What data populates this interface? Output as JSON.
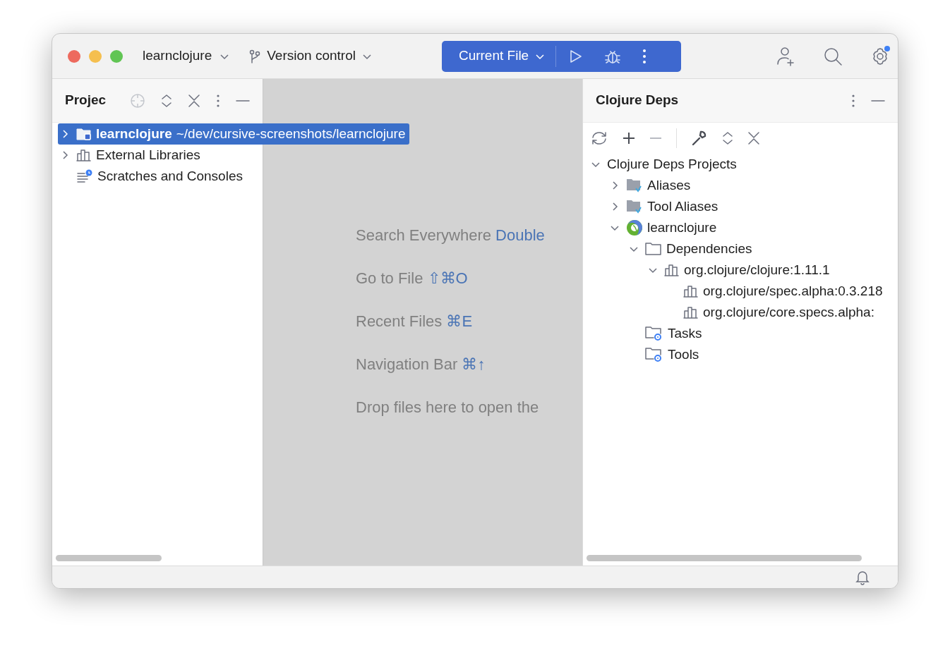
{
  "title_bar": {
    "project": "learnclojure",
    "vcs": "Version control",
    "run_config": "Current File"
  },
  "project_panel": {
    "title": "Projec",
    "tree": [
      {
        "label": "learnclojure",
        "path": "~/dev/cursive-screenshots/learnclojure",
        "kind": "module",
        "expanded": false,
        "selected": true
      },
      {
        "label": "External Libraries",
        "kind": "library",
        "expanded": false,
        "selected": false
      },
      {
        "label": "Scratches and Consoles",
        "kind": "scratches",
        "selected": false
      }
    ]
  },
  "editor": {
    "hints": [
      {
        "text": "Search Everywhere",
        "shortcut": "Double"
      },
      {
        "text": "Go to File",
        "shortcut": "⇧⌘O"
      },
      {
        "text": "Recent Files",
        "shortcut": "⌘E"
      },
      {
        "text": "Navigation Bar",
        "shortcut": "⌘↑"
      },
      {
        "text": "Drop files here to open the"
      }
    ]
  },
  "deps_panel": {
    "title": "Clojure Deps",
    "tree": [
      {
        "label": "Clojure Deps Projects",
        "expanded": true,
        "children": [
          {
            "label": "Aliases",
            "kind": "alias",
            "expanded": false
          },
          {
            "label": "Tool Aliases",
            "kind": "alias",
            "expanded": false
          },
          {
            "label": "learnclojure",
            "kind": "clojure",
            "expanded": true,
            "children": [
              {
                "label": "Dependencies",
                "kind": "folder",
                "expanded": true,
                "children": [
                  {
                    "label": "org.clojure/clojure:1.11.1",
                    "kind": "library",
                    "expanded": true,
                    "children": [
                      {
                        "label": "org.clojure/spec.alpha:0.3.218",
                        "kind": "library"
                      },
                      {
                        "label": "org.clojure/core.specs.alpha:",
                        "kind": "library"
                      }
                    ]
                  }
                ]
              },
              {
                "label": "Tasks",
                "kind": "gearfolder"
              },
              {
                "label": "Tools",
                "kind": "gearfolder"
              }
            ]
          }
        ]
      }
    ]
  }
}
